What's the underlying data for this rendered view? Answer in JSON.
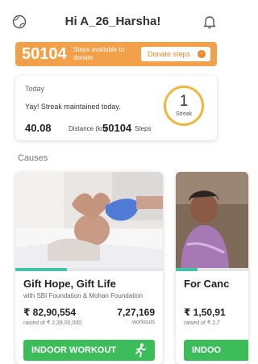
{
  "header": {
    "greeting": "Hi A_26_Harsha!",
    "left_icon": "globe-icon",
    "right_icon": "bell-icon"
  },
  "steps_banner": {
    "steps": "50104",
    "caption": "Steps available to donate",
    "donate_label": "Donate steps",
    "color": "#f3a04a"
  },
  "today": {
    "label": "Today",
    "message": "Yay! Streak maintained today.",
    "distance": "40.08",
    "distance_unit": "Distance (km)",
    "steps": "50104",
    "steps_unit": "Steps",
    "streak_count": "1",
    "streak_label": "Streak"
  },
  "causes": {
    "title": "Causes",
    "items": [
      {
        "title": "Gift Hope, Gift Life",
        "subtitle": "with SBI Foundation & Mohan Foundation",
        "raised": "₹ 82,90,554",
        "raised_of": "raised of ₹ 2,39,00,000",
        "workouts": "7,27,169",
        "workouts_label": "workouts",
        "cta": "INDOOR WORKOUT",
        "progress": 0.35
      },
      {
        "title": "For Canc",
        "raised": "₹ 1,50,91",
        "raised_of": "raised of ₹ 2,7",
        "cta": "INDOO",
        "progress": 0.3
      }
    ]
  }
}
